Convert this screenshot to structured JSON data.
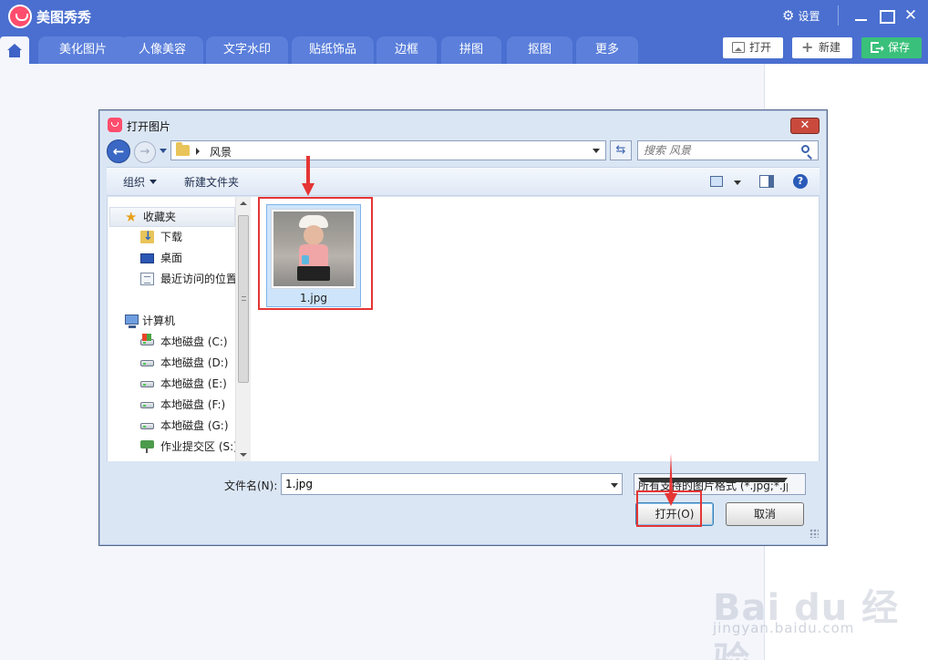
{
  "app": {
    "title": "美图秀秀",
    "settings_label": "设置",
    "close_glyph": "✕"
  },
  "tabs": [
    "美化图片",
    "人像美容",
    "文字水印",
    "贴纸饰品",
    "边框",
    "拼图",
    "抠图",
    "更多"
  ],
  "top_buttons": {
    "open_label": "打开",
    "new_label": "新建",
    "save_label": "保存"
  },
  "dialog": {
    "title": "打开图片",
    "close_glyph": "✕",
    "breadcrumb": "风景",
    "search_placeholder": "搜索 风景",
    "toolbar": {
      "organize_label": "组织",
      "new_folder_label": "新建文件夹",
      "help_glyph": "?"
    },
    "nav": {
      "favorites": "收藏夹",
      "downloads": "下载",
      "desktop": "桌面",
      "recent": "最近访问的位置",
      "computer": "计算机",
      "drives": [
        "本地磁盘 (C:)",
        "本地磁盘 (D:)",
        "本地磁盘 (E:)",
        "本地磁盘 (F:)",
        "本地磁盘 (G:)",
        "作业提交区 (S:)"
      ]
    },
    "files": [
      {
        "name": "1.jpg",
        "selected": true
      }
    ],
    "filename_label": "文件名(N):",
    "filename_value": "1.jpg",
    "filter_value": "所有支持的图片格式 (*.jpg;*.jp",
    "open_button": "打开(O)",
    "cancel_button": "取消"
  },
  "watermark": {
    "logo": "Bai du 经验",
    "url": "jingyan.baidu.com"
  },
  "colors": {
    "title_bar": "#4a6fd0",
    "tab": "#5b7fdb",
    "save_button": "#39c07a",
    "highlight": "#e53535",
    "selection": "#cde4fb"
  }
}
